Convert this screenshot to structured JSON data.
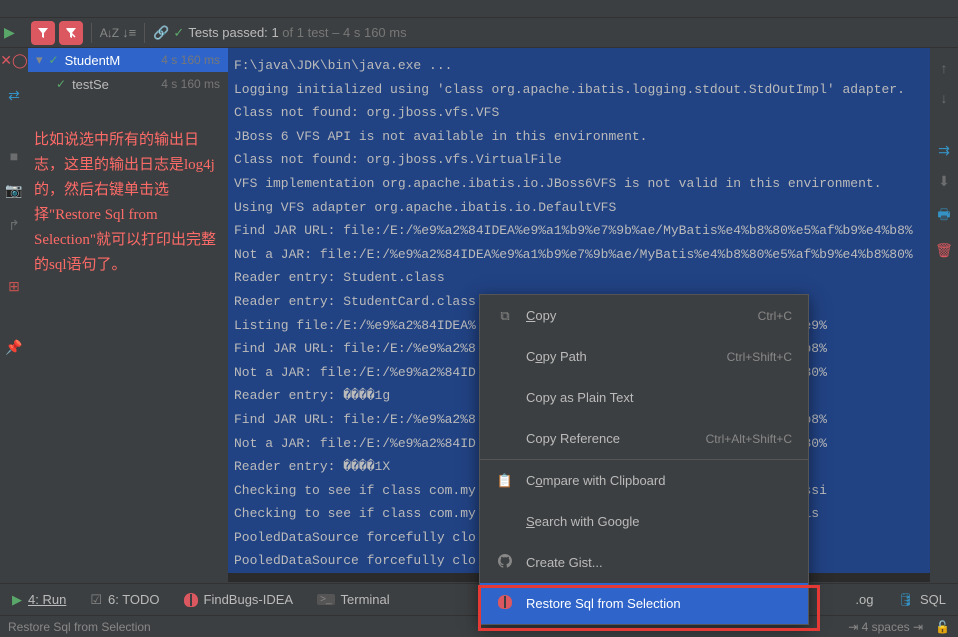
{
  "toolbar": {
    "tests_label": "Tests passed:",
    "tests_passed": "1",
    "tests_of": "of 1 test",
    "tests_time": "– 4 s 160 ms"
  },
  "tree": {
    "items": [
      {
        "name": "StudentM",
        "time": "4 s 160 ms"
      },
      {
        "name": "testSe",
        "time": "4 s 160 ms"
      }
    ]
  },
  "annotation": "比如说选中所有的输出日志，这里的输出日志是log4j的，然后右键单击选择\"Restore Sql from Selection\"就可以打印出完整的sql语句了。",
  "console_lines": [
    "F:\\java\\JDK\\bin\\java.exe ...",
    "Logging initialized using 'class org.apache.ibatis.logging.stdout.StdOutImpl' adapter.",
    "Class not found: org.jboss.vfs.VFS",
    "JBoss 6 VFS API is not available in this environment.",
    "Class not found: org.jboss.vfs.VirtualFile",
    "VFS implementation org.apache.ibatis.io.JBoss6VFS is not valid in this environment.",
    "Using VFS adapter org.apache.ibatis.io.DefaultVFS",
    "Find JAR URL: file:/E:/%e9%a2%84IDEA%e9%a1%b9%e7%9b%ae/MyBatis%e4%b8%80%e5%af%b9%e4%b8%",
    "Not a JAR: file:/E:/%e9%a2%84IDEA%e9%a1%b9%e7%9b%ae/MyBatis%e4%b8%80%e5%af%b9%e4%b8%80%",
    "Reader entry: Student.class",
    "Reader entry: StudentCard.class",
    "Listing file:/E:/%e9%a2%84IDEA%                              b9%e4%b8%80%e9%",
    "Find JAR URL: file:/E:/%e9%a2%8                              e5%af%b9%e4%b8%",
    "Not a JAR: file:/E:/%e9%a2%84ID                              af%b9%e4%b8%80%",
    "Reader entry: ����1g",
    "Find JAR URL: file:/E:/%e9%a2%8                              e5%af%b9%e4%b8%",
    "Not a JAR: file:/E:/%e9%a2%84ID                              af%b9%e4%b8%80%",
    "Reader entry: ����1X",
    "Checking to see if class com.my                              iteria [is assi",
    "Checking to see if class com.my                              s criteria [is ",
    "PooledDataSource forcefully clo",
    "PooledDataSource forcefully clo"
  ],
  "context_menu": {
    "items": [
      {
        "icon": "copy",
        "label": "Copy",
        "shortcut": "Ctrl+C",
        "u": "C"
      },
      {
        "icon": "",
        "label": "Copy Path",
        "shortcut": "Ctrl+Shift+C",
        "u": "o"
      },
      {
        "icon": "",
        "label": "Copy as Plain Text",
        "shortcut": ""
      },
      {
        "icon": "",
        "label": "Copy Reference",
        "shortcut": "Ctrl+Alt+Shift+C"
      },
      {
        "sep": true
      },
      {
        "icon": "clipboard",
        "label": "Compare with Clipboard",
        "u": "o"
      },
      {
        "icon": "",
        "label": "Search with Google",
        "u": "S"
      },
      {
        "icon": "github",
        "label": "Create Gist..."
      },
      {
        "icon": "ladybug",
        "label": "Restore Sql from Selection",
        "selected": true
      }
    ]
  },
  "bottom_tabs": [
    {
      "icon": "run",
      "label": "4: Run",
      "u": "4"
    },
    {
      "icon": "todo",
      "label": "6: TODO",
      "u": "6"
    },
    {
      "icon": "bug",
      "label": "FindBugs-IDEA"
    },
    {
      "icon": "term",
      "label": "Terminal"
    },
    {
      "icon": "log",
      "label": ".og"
    },
    {
      "icon": "db",
      "label": "SQL"
    }
  ],
  "statusbar": {
    "left": "Restore Sql from Selection",
    "spaces": "4 spaces"
  }
}
